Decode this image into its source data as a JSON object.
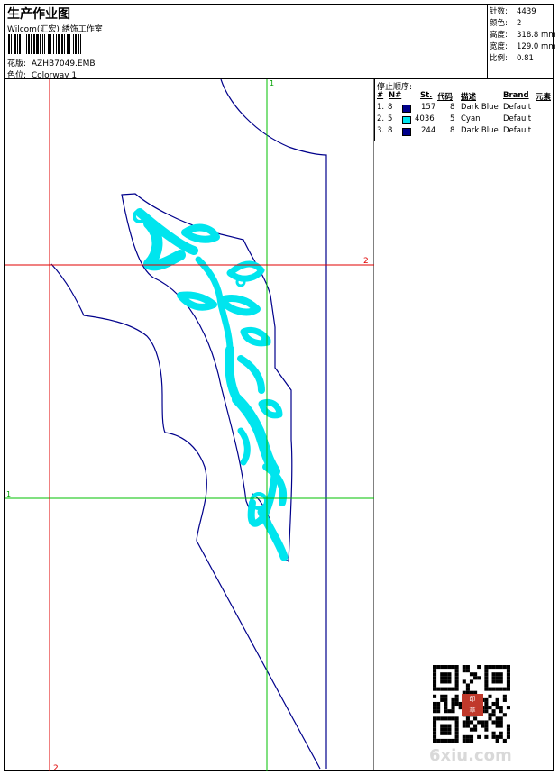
{
  "header": {
    "title": "生产作业图",
    "studio": "Wilcom(汇宏) 綉饰工作室",
    "design_label": "花版:",
    "design_value": "AZHB7049.EMB",
    "colorway_label": "色位:",
    "colorway_value": "Colorway 1"
  },
  "specs": [
    {
      "label": "针数:",
      "value": "4439"
    },
    {
      "label": "颜色:",
      "value": "2"
    },
    {
      "label": "高度:",
      "value": "318.8 mm"
    },
    {
      "label": "宽度:",
      "value": "129.0 mm"
    },
    {
      "label": "比例:",
      "value": "0.81"
    }
  ],
  "stop_sequence": {
    "title": "停止顺序:",
    "headers": {
      "num": "#",
      "needle": "N#",
      "stitches": "St.",
      "code": "代码",
      "desc": "描述",
      "brand": "Brand",
      "element": "元素"
    },
    "rows": [
      {
        "num": "1.",
        "needle": "8",
        "color": "#00008b",
        "stitches": "157",
        "code": "8",
        "desc": "Dark Blue",
        "brand": "Default"
      },
      {
        "num": "2.",
        "needle": "5",
        "color": "#00e5ee",
        "stitches": "4036",
        "code": "5",
        "desc": "Cyan",
        "brand": "Default"
      },
      {
        "num": "3.",
        "needle": "8",
        "color": "#00008b",
        "stitches": "244",
        "code": "8",
        "desc": "Dark Blue",
        "brand": "Default"
      }
    ]
  },
  "guides": {
    "v1": "1",
    "h2": "2",
    "h1": "1",
    "v2": "2",
    "vertical_color": "#00c000",
    "horizontal_color": "#e00000"
  },
  "colors": {
    "outline": "#00008b",
    "embroidery": "#00e5ee"
  },
  "watermark": "6xiu.com"
}
